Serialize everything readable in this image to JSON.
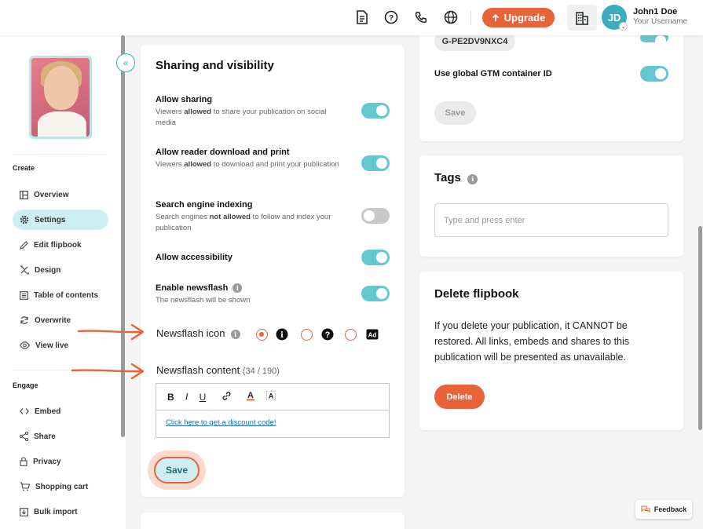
{
  "topbar": {
    "upgrade_label": "Upgrade",
    "user_name": "John1 Doe",
    "user_sub": "Your Username",
    "avatar_initials": "JD",
    "icons": [
      "document-icon",
      "help-icon",
      "phone-icon",
      "globe-icon",
      "organization-icon"
    ]
  },
  "sidebar": {
    "cover_text": "",
    "section_create": "Create",
    "section_engage": "Engage",
    "create_items": [
      {
        "label": "Overview",
        "icon": "overview-icon"
      },
      {
        "label": "Settings",
        "icon": "gear-icon",
        "active": true
      },
      {
        "label": "Edit flipbook",
        "icon": "pencil-icon"
      },
      {
        "label": "Design",
        "icon": "design-icon"
      },
      {
        "label": "Table of contents",
        "icon": "toc-icon"
      },
      {
        "label": "Overwrite",
        "icon": "refresh-icon"
      },
      {
        "label": "View live",
        "icon": "eye-icon"
      }
    ],
    "engage_items": [
      {
        "label": "Embed",
        "icon": "code-icon"
      },
      {
        "label": "Share",
        "icon": "share-icon"
      },
      {
        "label": "Privacy",
        "icon": "lock-icon"
      },
      {
        "label": "Shopping cart",
        "icon": "cart-icon"
      },
      {
        "label": "Bulk import",
        "icon": "import-icon"
      }
    ]
  },
  "sharing": {
    "title": "Sharing and visibility",
    "settings": [
      {
        "title": "Allow sharing",
        "desc_pre": "Viewers ",
        "desc_bold": "allowed",
        "desc_post": " to share your publication on social media",
        "on": true
      },
      {
        "title": "Allow reader download and print",
        "desc_pre": "Viewers ",
        "desc_bold": "allowed",
        "desc_post": " to download and print your publication",
        "on": true
      },
      {
        "title": "Search engine indexing",
        "desc_pre": "Search engines ",
        "desc_bold": "not allowed",
        "desc_post": " to follow and index your publication",
        "on": false
      },
      {
        "title": "Allow accessibility",
        "desc_pre": "",
        "desc_bold": "",
        "desc_post": "",
        "on": true
      },
      {
        "title": "Enable newsflash",
        "desc_pre": "The newsflash will be shown",
        "desc_bold": "",
        "desc_post": "",
        "on": true
      }
    ],
    "newsflash_icon_label": "Newsflash icon",
    "newsflash_content_label": "Newsflash content",
    "newsflash_count": "(34 / 190)",
    "editor_buttons": {
      "bold": "B",
      "italic": "I",
      "underline": "U"
    },
    "newsflash_link": "Click here to get a discount code!",
    "save_label": "Save"
  },
  "gtm": {
    "container_id": "G-PE2DV9NXC4",
    "global_label": "Use global GTM container ID",
    "save_label": "Save"
  },
  "tags": {
    "title": "Tags",
    "placeholder": "Type and press enter"
  },
  "delete": {
    "title": "Delete flipbook",
    "text": "If you delete your publication, it CANNOT be restored. All links, embeds and shares to this publication will be presented as unavailable.",
    "button_label": "Delete"
  },
  "feedback_label": "Feedback",
  "colors": {
    "accent": "#e8623a",
    "teal": "#63c8cf",
    "active_bg": "#cdeff3"
  }
}
